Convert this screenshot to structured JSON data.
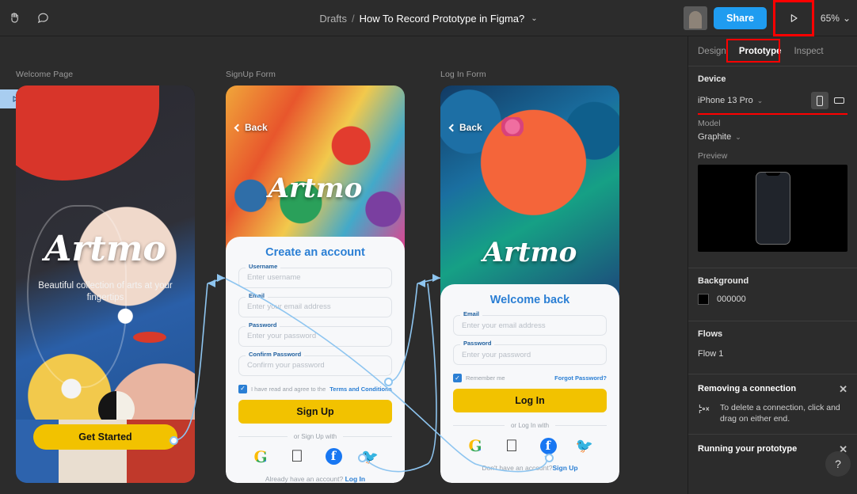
{
  "topbar": {
    "hand_tool": "hand-tool",
    "comment_tool": "comment-tool",
    "breadcrumb_root": "Drafts",
    "breadcrumb_sep": "/",
    "file_name": "How To Record Prototype in Figma?",
    "file_caret": "⌄",
    "share_label": "Share",
    "present_label": "present",
    "zoom_level": "65%",
    "zoom_caret": "⌄"
  },
  "canvas": {
    "frames": [
      {
        "label": "Welcome Page"
      },
      {
        "label": "SignUp Form"
      },
      {
        "label": "Log In Form"
      }
    ],
    "welcome": {
      "brand": "Artmo",
      "tagline": "Beautiful collection of arts  at your fingertips",
      "cta": "Get Started"
    },
    "signup": {
      "back": "Back",
      "brand": "Artmo",
      "title": "Create an account",
      "fields": [
        {
          "label": "Username",
          "placeholder": "Enter username"
        },
        {
          "label": "Email",
          "placeholder": "Enter your email address"
        },
        {
          "label": "Password",
          "placeholder": "Enter your password"
        },
        {
          "label": "Confirm Password",
          "placeholder": "Confirm your password"
        }
      ],
      "terms_prefix": "I have read and agree to the ",
      "terms_link": "Terms and Conditions",
      "cta": "Sign Up",
      "divider": "or Sign Up with",
      "socials": [
        "google-icon",
        "apple-icon",
        "facebook-icon",
        "twitter-icon"
      ],
      "bottom_prefix": "Already have an account?  ",
      "bottom_link": "Log In"
    },
    "login": {
      "back": "Back",
      "brand": "Artmo",
      "title": "Welcome back",
      "fields": [
        {
          "label": "Email",
          "placeholder": "Enter your email address"
        },
        {
          "label": "Password",
          "placeholder": "Enter your password"
        }
      ],
      "remember": "Remember me",
      "forgot": "Forgot Password?",
      "cta": "Log In",
      "divider": "or Log In with",
      "socials": [
        "google-icon",
        "apple-icon",
        "facebook-icon",
        "twitter-icon"
      ],
      "bottom_prefix": "Don't have an account?",
      "bottom_link": "Sign Up"
    }
  },
  "panel": {
    "tabs": [
      {
        "label": "Design",
        "active": false
      },
      {
        "label": "Prototype",
        "active": true
      },
      {
        "label": "Inspect",
        "active": false
      }
    ],
    "device": {
      "title": "Device",
      "value": "iPhone 13 Pro",
      "caret": "⌄",
      "orientation_selected": "portrait"
    },
    "model": {
      "label": "Model",
      "value": "Graphite",
      "caret": "⌄"
    },
    "preview": {
      "label": "Preview"
    },
    "background": {
      "title": "Background",
      "value": "000000",
      "color": "#000000"
    },
    "flows": {
      "title": "Flows",
      "items": [
        "Flow 1"
      ]
    },
    "tips": [
      {
        "title": "Removing a connection",
        "body": "To delete a connection, click and drag on either end.",
        "close": "✕"
      },
      {
        "title": "Running your prototype",
        "body": "",
        "close": "✕"
      }
    ],
    "help": "?"
  },
  "colors": {
    "accent_blue": "#1f9cf0",
    "highlight_red": "#ff0000",
    "cta_yellow": "#f2c200",
    "link_blue": "#2b7fd4",
    "connection_blue": "#8ec5f0"
  }
}
